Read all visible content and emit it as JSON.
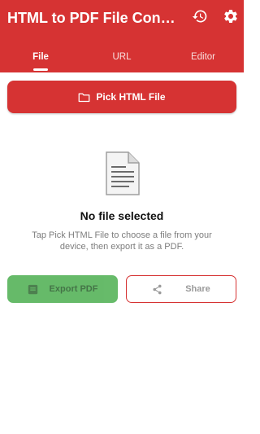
{
  "colors": {
    "primary": "#D63333",
    "export_green": "#4CAF50"
  },
  "appbar": {
    "title": "HTML to PDF File Conver…",
    "history_icon": "history-icon",
    "settings_icon": "gear-icon"
  },
  "tabs": [
    {
      "label": "File",
      "active": true
    },
    {
      "label": "URL",
      "active": false
    },
    {
      "label": "Editor",
      "active": false
    }
  ],
  "pick_button": {
    "label": "Pick HTML File",
    "icon": "folder-icon"
  },
  "empty_state": {
    "icon": "document-icon",
    "title": "No file selected",
    "description": "Tap Pick HTML File to choose a file from your device, then export it as a PDF."
  },
  "actions": {
    "export_label": "Export PDF",
    "export_icon": "pdf-icon",
    "share_label": "Share",
    "share_icon": "share-icon"
  }
}
